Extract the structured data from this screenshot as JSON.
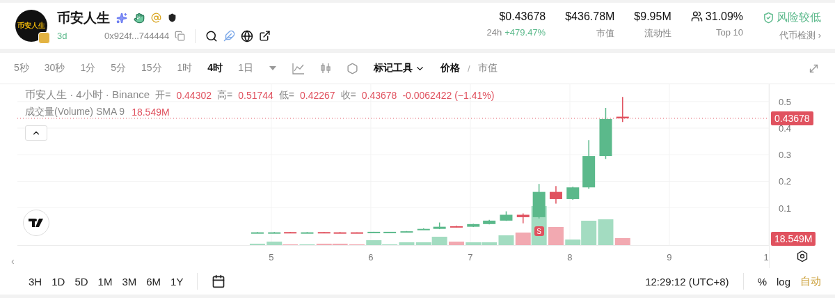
{
  "header": {
    "avatar_text": "币安人生",
    "name": "币安人生",
    "age": "3d",
    "address": "0x924f...744444",
    "stats": [
      {
        "kind": "price",
        "value": "$0.43678",
        "prefix": "24h",
        "label": "+479.47%"
      },
      {
        "kind": "plain",
        "value": "$436.78M",
        "label": "市值"
      },
      {
        "kind": "plain",
        "value": "$9.95M",
        "label": "流动性"
      },
      {
        "kind": "holders",
        "value": "31.09%",
        "label": "Top 10"
      },
      {
        "kind": "risk",
        "value": "风险较低",
        "label": "代币检测",
        "arrow": "›"
      }
    ]
  },
  "toolbar": {
    "intervals": [
      {
        "label": "5秒",
        "selected": false
      },
      {
        "label": "30秒",
        "selected": false
      },
      {
        "label": "1分",
        "selected": false
      },
      {
        "label": "5分",
        "selected": false
      },
      {
        "label": "15分",
        "selected": false
      },
      {
        "label": "1时",
        "selected": false
      },
      {
        "label": "4时",
        "selected": true
      },
      {
        "label": "1日",
        "selected": false
      }
    ],
    "drawing_tools": "标记工具",
    "price_modes": [
      {
        "label": "价格",
        "selected": true
      },
      {
        "label": "市值",
        "selected": false
      }
    ],
    "mode_separator": "/"
  },
  "chart": {
    "legend": {
      "symbol": "币安人生 · 4小时 · Binance",
      "ohlc": [
        {
          "label": "开=",
          "value": "0.44302"
        },
        {
          "label": "高=",
          "value": "0.51744"
        },
        {
          "label": "低=",
          "value": "0.42267"
        },
        {
          "label": "收=",
          "value": "0.43678"
        }
      ],
      "change": "-0.0062422 (−1.41%)"
    },
    "volume_legend": {
      "label": "成交量(Volume) SMA 9",
      "value": "18.549M"
    },
    "collapse_arrow": "‹",
    "price_badge": "0.43678",
    "volume_badge": "18.549M",
    "marker": {
      "label": "S"
    },
    "price_axis": [
      "0.5",
      "0.4",
      "0.3",
      "0.2",
      "0.1"
    ],
    "time_axis": [
      "5",
      "6",
      "7",
      "8",
      "9",
      "1"
    ]
  },
  "bottom_bar": {
    "ranges": [
      {
        "label": "3H",
        "selected": false
      },
      {
        "label": "1D",
        "selected": false
      },
      {
        "label": "5D",
        "selected": false
      },
      {
        "label": "1M",
        "selected": false
      },
      {
        "label": "3M",
        "selected": false
      },
      {
        "label": "6M",
        "selected": false
      },
      {
        "label": "1Y",
        "selected": false
      }
    ],
    "time": "12:29:12 (UTC+8)",
    "scale_modes": [
      {
        "label": "%",
        "selected": false
      },
      {
        "label": "log",
        "selected": false
      },
      {
        "label": "自动",
        "selected": true
      }
    ]
  }
}
